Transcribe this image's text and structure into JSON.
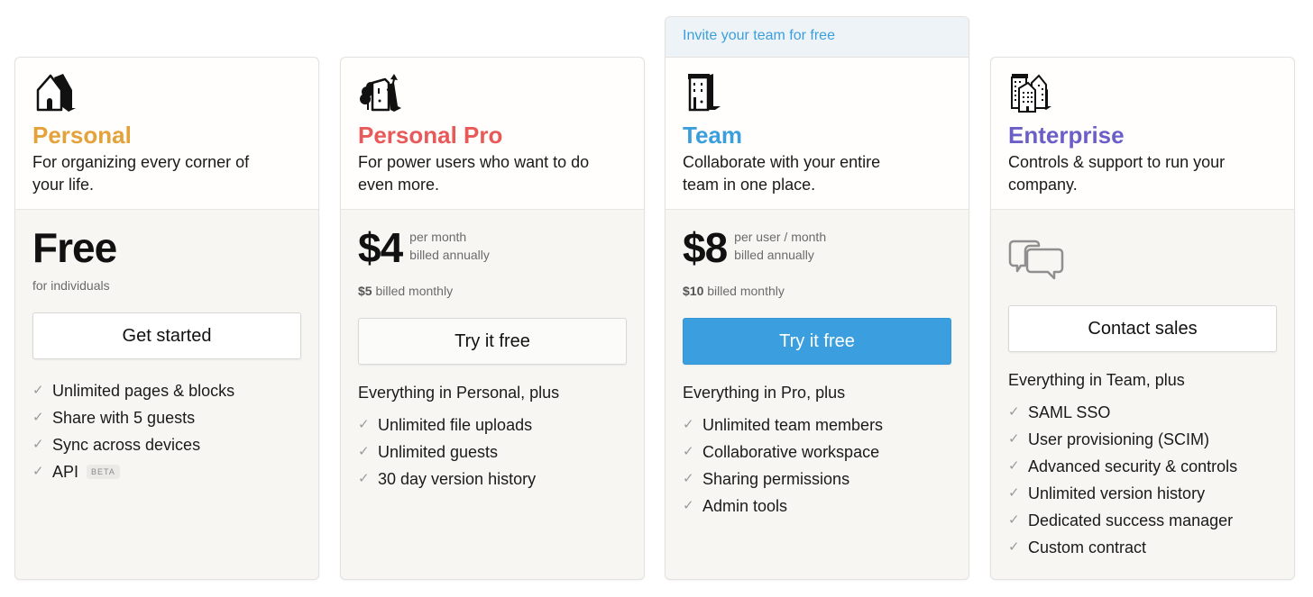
{
  "plans": [
    {
      "id": "personal",
      "icon": "house-icon",
      "name": "Personal",
      "color": "#e3a23a",
      "description": "For organizing every corner of your life.",
      "price": "Free",
      "price_note_1": "",
      "price_note_2": "",
      "price_sub_bold": "",
      "price_sub": "for individuals",
      "cta_label": "Get started",
      "features_heading": "",
      "features": [
        {
          "label": "Unlimited pages & blocks",
          "badge": ""
        },
        {
          "label": "Share with 5 guests",
          "badge": ""
        },
        {
          "label": "Sync across devices",
          "badge": ""
        },
        {
          "label": "API",
          "badge": "BETA"
        }
      ]
    },
    {
      "id": "personal-pro",
      "icon": "house-with-tree-icon",
      "name": "Personal Pro",
      "color": "#e85a5a",
      "description": "For power users who want to do even more.",
      "price": "$4",
      "price_note_1": "per month",
      "price_note_2": "billed annually",
      "price_sub_bold": "$5",
      "price_sub": " billed monthly",
      "cta_label": "Try it free",
      "features_heading": "Everything in Personal, plus",
      "features": [
        {
          "label": "Unlimited file uploads"
        },
        {
          "label": "Unlimited guests"
        },
        {
          "label": "30 day version history"
        }
      ]
    },
    {
      "id": "team",
      "banner": "Invite your team for free",
      "icon": "building-icon",
      "name": "Team",
      "color": "#3b9fdc",
      "description": "Collaborate with your entire team in one place.",
      "price": "$8",
      "price_note_1": "per user / month",
      "price_note_2": "billed annually",
      "price_sub_bold": "$10",
      "price_sub": " billed monthly",
      "cta_label": "Try it free",
      "features_heading": "Everything in Pro, plus",
      "features": [
        {
          "label": "Unlimited team members"
        },
        {
          "label": "Collaborative workspace"
        },
        {
          "label": "Sharing permissions"
        },
        {
          "label": "Admin tools"
        }
      ]
    },
    {
      "id": "enterprise",
      "icon": "city-buildings-icon",
      "name": "Enterprise",
      "color": "#6b5fc7",
      "description": "Controls & support to run your company.",
      "price_icon": "chat-bubbles-icon",
      "cta_label": "Contact sales",
      "features_heading": "Everything in Team, plus",
      "features": [
        {
          "label": "SAML SSO"
        },
        {
          "label": "User provisioning (SCIM)"
        },
        {
          "label": "Advanced security & controls"
        },
        {
          "label": "Unlimited version history"
        },
        {
          "label": "Dedicated success manager"
        },
        {
          "label": "Custom contract"
        }
      ]
    }
  ],
  "check_glyph": "✓"
}
